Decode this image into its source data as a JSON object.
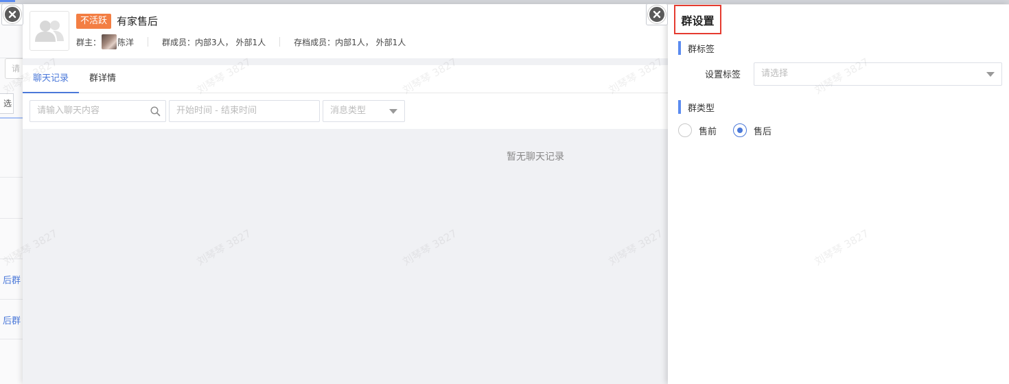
{
  "background": {
    "input_fragment": "请",
    "button_fragment": "选",
    "link_fragment_1": "后群",
    "link_fragment_2": "后群"
  },
  "group": {
    "status_tag": "不活跃",
    "name": "有家售后",
    "owner_label": "群主：",
    "owner_name": "陈洋",
    "members": "群成员：内部3人， 外部1人",
    "archived_members": "存档成员：内部1人， 外部1人"
  },
  "tabs": [
    {
      "label": "聊天记录",
      "active": true
    },
    {
      "label": "群详情",
      "active": false
    }
  ],
  "filters": {
    "search_placeholder": "请输入聊天内容",
    "date_placeholder": "开始时间 - 结束时间",
    "type_placeholder": "消息类型"
  },
  "chat": {
    "empty_text": "暂无聊天记录"
  },
  "settings": {
    "title": "群设置",
    "tag_section": "群标签",
    "tag_label": "设置标签",
    "tag_placeholder": "请选择",
    "type_section": "群类型",
    "type_options": [
      {
        "label": "售前",
        "checked": false
      },
      {
        "label": "售后",
        "checked": true
      }
    ]
  },
  "watermark": "刘琴琴 3827",
  "colors": {
    "accent": "#4a78d9",
    "status_tag": "#f37e43",
    "highlight_border": "#e53a2f"
  }
}
